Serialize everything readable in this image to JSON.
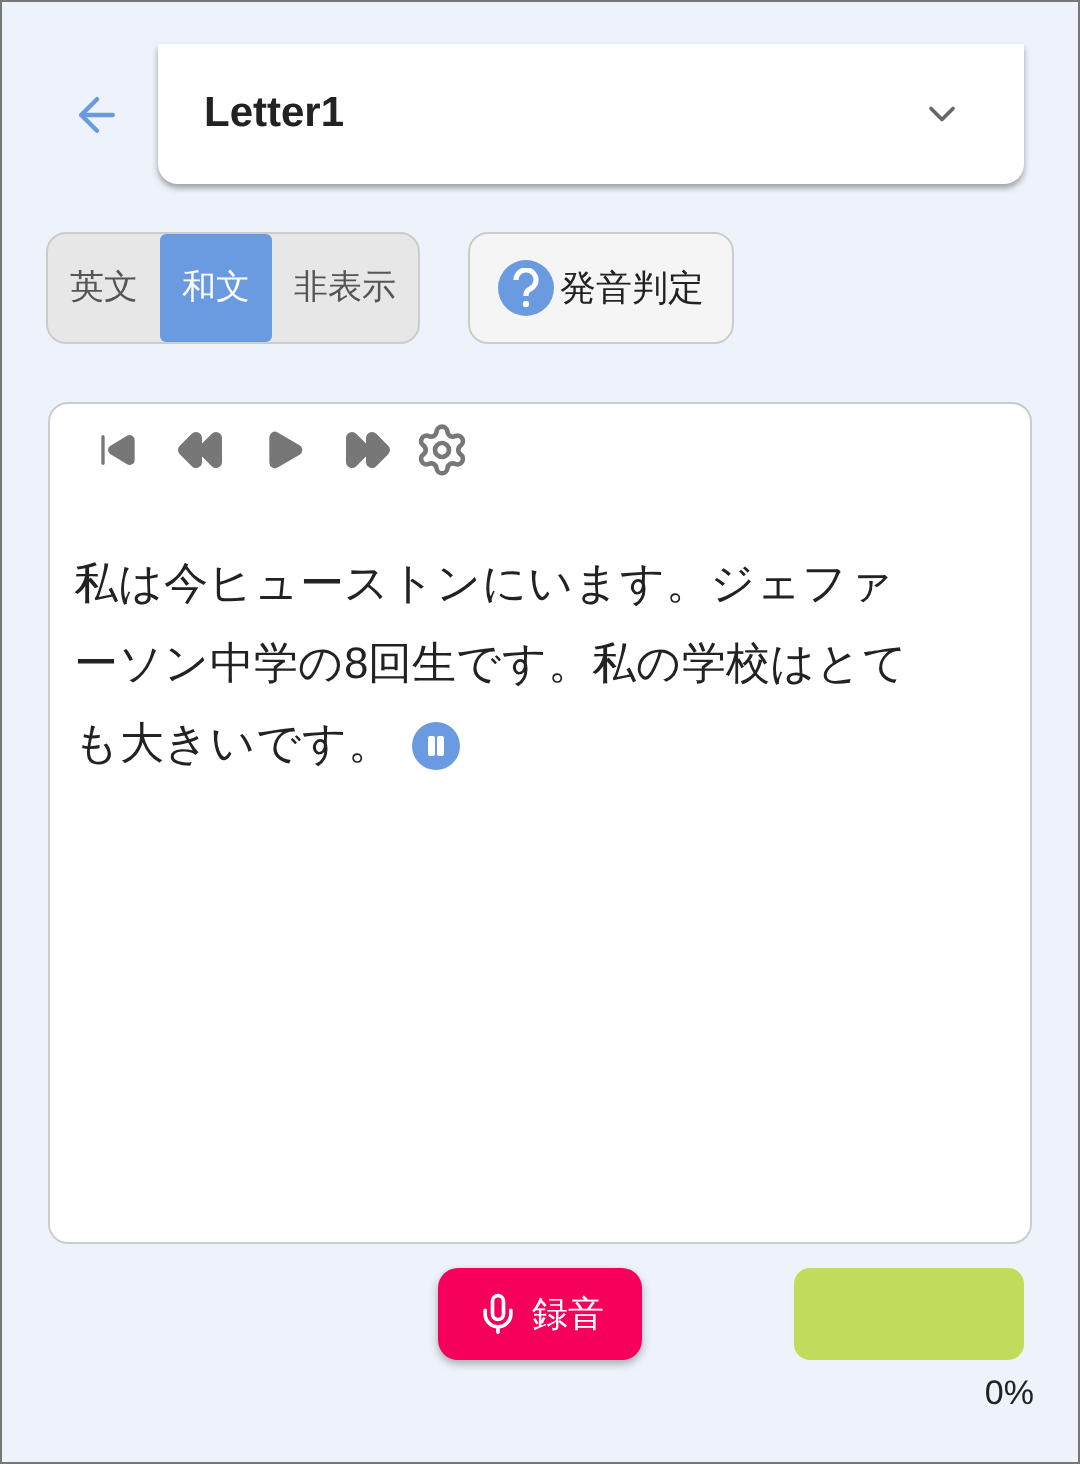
{
  "header": {
    "title": "Letter1"
  },
  "tabs": [
    {
      "label": "英文",
      "selected": false
    },
    {
      "label": "和文",
      "selected": true
    },
    {
      "label": "非表示",
      "selected": false
    }
  ],
  "judge_button": {
    "label": "発音判定"
  },
  "player": {
    "text": "私は今ヒューストンにいます。ジェファーソン中学の8回生です。私の学校はとても大きいです。",
    "playing": true
  },
  "record_button": {
    "label": "録音"
  },
  "score": {
    "reading": "0%"
  }
}
